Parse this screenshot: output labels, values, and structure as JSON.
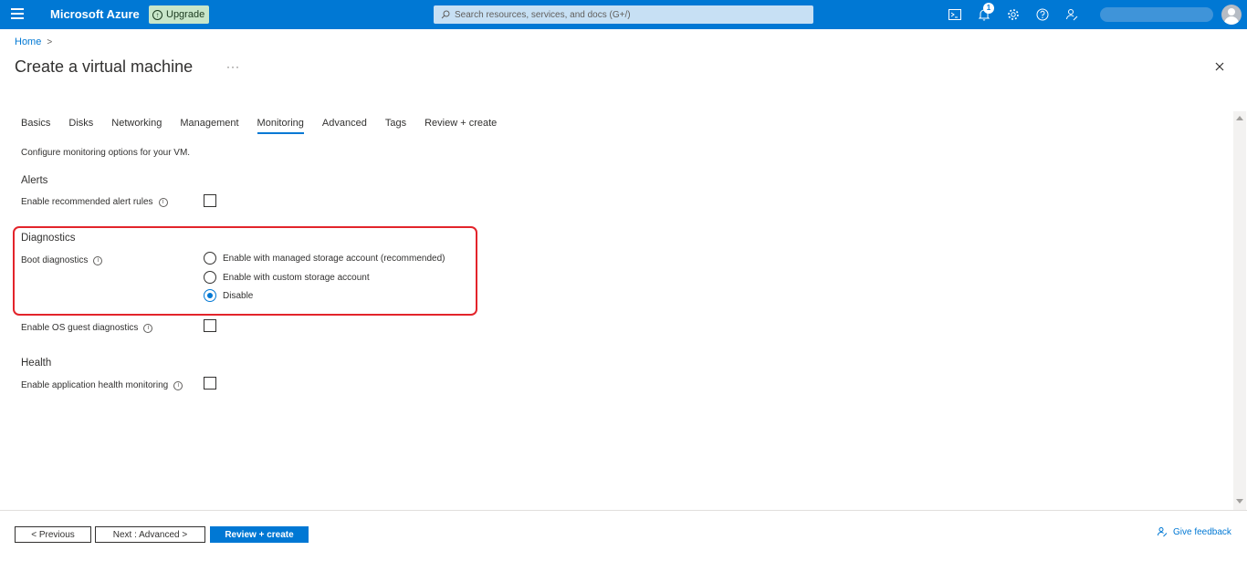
{
  "topbar": {
    "brand": "Microsoft Azure",
    "upgrade_label": "Upgrade",
    "search_placeholder": "Search resources, services, and docs (G+/)",
    "notifications_count": "1",
    "accent_color": "#0078d4"
  },
  "breadcrumb": {
    "home": "Home",
    "separator": ">"
  },
  "page": {
    "title": "Create a virtual machine",
    "more": "···"
  },
  "tabs": [
    {
      "label": "Basics"
    },
    {
      "label": "Disks"
    },
    {
      "label": "Networking"
    },
    {
      "label": "Management"
    },
    {
      "label": "Monitoring",
      "active": true
    },
    {
      "label": "Advanced"
    },
    {
      "label": "Tags"
    },
    {
      "label": "Review + create"
    }
  ],
  "description": "Configure monitoring options for your VM.",
  "alerts": {
    "heading": "Alerts",
    "recommended_rules_label": "Enable recommended alert rules",
    "recommended_rules_checked": false
  },
  "diagnostics": {
    "heading": "Diagnostics",
    "boot_label": "Boot diagnostics",
    "boot_options": [
      "Enable with managed storage account (recommended)",
      "Enable with custom storage account",
      "Disable"
    ],
    "boot_selected": "Disable",
    "os_guest_label": "Enable OS guest diagnostics",
    "os_guest_checked": false
  },
  "health": {
    "heading": "Health",
    "app_health_label": "Enable application health monitoring",
    "app_health_checked": false
  },
  "footer": {
    "previous": "< Previous",
    "next": "Next : Advanced >",
    "review": "Review + create",
    "feedback": "Give feedback"
  }
}
